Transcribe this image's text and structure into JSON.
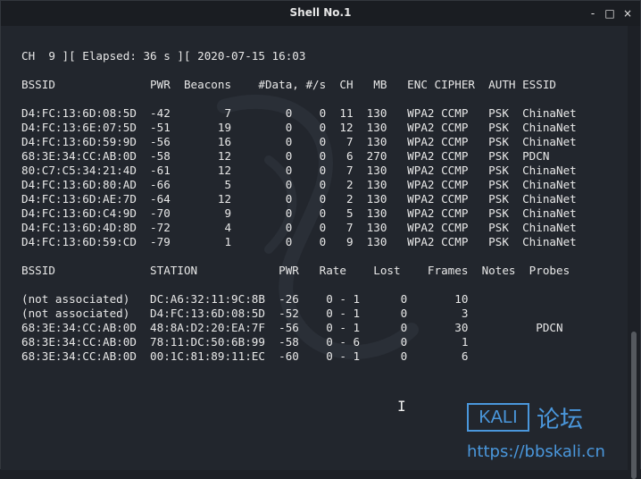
{
  "window": {
    "title": "Shell No.1",
    "buttons": {
      "minimize": "-",
      "maximize": "□",
      "close": "×"
    }
  },
  "terminal": {
    "status_line": "CH  9 ][ Elapsed: 36 s ][ 2020-07-15 16:03",
    "ap_header": "BSSID              PWR  Beacons    #Data, #/s  CH   MB   ENC CIPHER  AUTH ESSID",
    "ap_rows": [
      "D4:FC:13:6D:08:5D  -42        7        0    0  11  130   WPA2 CCMP   PSK  ChinaNet",
      "D4:FC:13:6E:07:5D  -51       19        0    0  12  130   WPA2 CCMP   PSK  ChinaNet",
      "D4:FC:13:6D:59:9D  -56       16        0    0   7  130   WPA2 CCMP   PSK  ChinaNet",
      "68:3E:34:CC:AB:0D  -58       12        0    0   6  270   WPA2 CCMP   PSK  PDCN",
      "80:C7:C5:34:21:4D  -61       12        0    0   7  130   WPA2 CCMP   PSK  ChinaNet",
      "D4:FC:13:6D:80:AD  -66        5        0    0   2  130   WPA2 CCMP   PSK  ChinaNet",
      "D4:FC:13:6D:AE:7D  -64       12        0    0   2  130   WPA2 CCMP   PSK  ChinaNet",
      "D4:FC:13:6D:C4:9D  -70        9        0    0   5  130   WPA2 CCMP   PSK  ChinaNet",
      "D4:FC:13:6D:4D:8D  -72        4        0    0   7  130   WPA2 CCMP   PSK  ChinaNet",
      "D4:FC:13:6D:59:CD  -79        1        0    0   9  130   WPA2 CCMP   PSK  ChinaNet"
    ],
    "station_header": "BSSID              STATION            PWR   Rate    Lost    Frames  Notes  Probes",
    "station_rows": [
      "(not associated)   DC:A6:32:11:9C:8B  -26    0 - 1      0       10",
      "(not associated)   D4:FC:13:6D:08:5D  -52    0 - 1      0        3",
      "68:3E:34:CC:AB:0D  48:8A:D2:20:EA:7F  -56    0 - 1      0       30          PDCN",
      "68:3E:34:CC:AB:0D  78:11:DC:50:6B:99  -58    0 - 6      0        1",
      "68:3E:34:CC:AB:0D  00:1C:81:89:11:EC  -60    0 - 1      0        6"
    ]
  },
  "watermark": {
    "logo_text": "KALI",
    "label_cn": "论坛",
    "url": "https://bbskali.cn"
  },
  "colors": {
    "terminal_bg": "#22262d",
    "text": "#e8e8e8",
    "watermark": "#4a97dc"
  }
}
